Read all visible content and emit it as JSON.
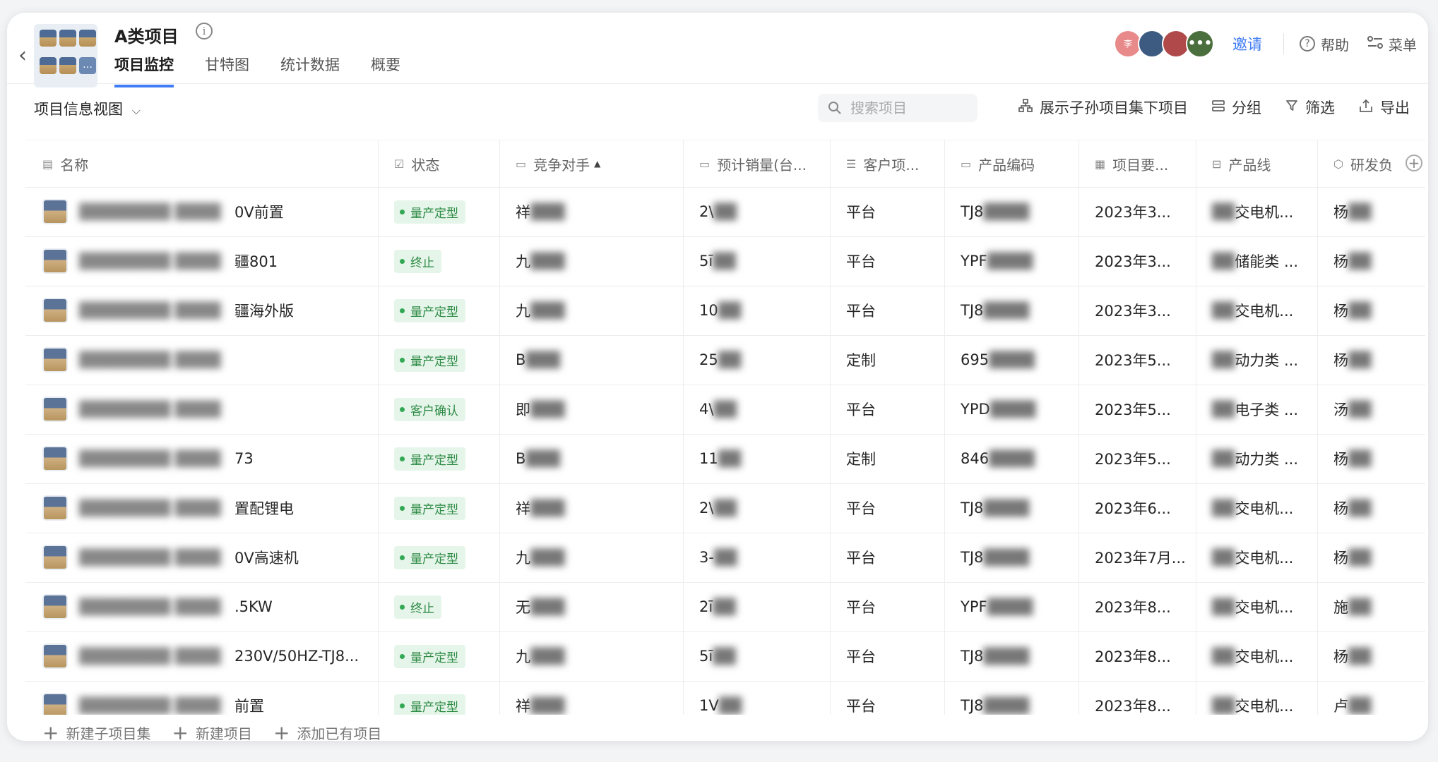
{
  "header": {
    "title": "A类项目",
    "tabs": [
      {
        "label": "项目监控",
        "active": true
      },
      {
        "label": "甘特图",
        "active": false
      },
      {
        "label": "统计数据",
        "active": false
      },
      {
        "label": "概要",
        "active": false
      }
    ],
    "avatars": [
      "李",
      "",
      "",
      "•••"
    ],
    "invite_label": "邀请",
    "help_label": "帮助",
    "menu_label": "菜单"
  },
  "toolbar": {
    "view_label": "项目信息视图",
    "search_placeholder": "搜索项目",
    "show_sub_label": "展示子孙项目集下项目",
    "group_label": "分组",
    "filter_label": "筛选",
    "export_label": "导出"
  },
  "table": {
    "headers": {
      "name": "名称",
      "status": "状态",
      "competitor": "竞争对手",
      "sales": "预计销量(台...",
      "customer": "客户项...",
      "code": "产品编码",
      "date": "项目要...",
      "line": "产品线",
      "rd": "研发负"
    },
    "rows": [
      {
        "name_suffix": "0V前置",
        "status": "量产定型",
        "competitor": "祥",
        "sales": "2\\",
        "customer": "平台",
        "code": "TJ8",
        "date": "2023年3...",
        "line": "交电机...",
        "rd": "杨"
      },
      {
        "name_suffix": "疆801",
        "status": "终止",
        "competitor": "九",
        "sales": "5ī",
        "customer": "平台",
        "code": "YPF",
        "date": "2023年3...",
        "line": "储能类 ...",
        "rd": "杨"
      },
      {
        "name_suffix": "疆海外版",
        "status": "量产定型",
        "competitor": "九",
        "sales": "10",
        "customer": "平台",
        "code": "TJ8",
        "date": "2023年3...",
        "line": "交电机...",
        "rd": "杨"
      },
      {
        "name_suffix": "",
        "status": "量产定型",
        "competitor": "B",
        "sales": "25",
        "customer": "定制",
        "code": "695",
        "date": "2023年5...",
        "line": "动力类 ...",
        "rd": "杨"
      },
      {
        "name_suffix": "",
        "status": "客户确认",
        "competitor": "即",
        "sales": "4\\",
        "customer": "平台",
        "code": "YPD",
        "date": "2023年5...",
        "line": "电子类 ...",
        "rd": "汤"
      },
      {
        "name_suffix": "73",
        "status": "量产定型",
        "competitor": "B",
        "sales": "11",
        "customer": "定制",
        "code": "846",
        "date": "2023年5...",
        "line": "动力类 ...",
        "rd": "杨"
      },
      {
        "name_suffix": "置配锂电",
        "status": "量产定型",
        "competitor": "祥",
        "sales": "2\\",
        "customer": "平台",
        "code": "TJ8",
        "date": "2023年6...",
        "line": "交电机...",
        "rd": "杨"
      },
      {
        "name_suffix": "0V高速机",
        "status": "量产定型",
        "competitor": "九",
        "sales": "3-",
        "customer": "平台",
        "code": "TJ8",
        "date": "2023年7月...",
        "line": "交电机...",
        "rd": "杨"
      },
      {
        "name_suffix": ".5KW",
        "status": "终止",
        "competitor": "无",
        "sales": "2ī",
        "customer": "平台",
        "code": "YPF",
        "date": "2023年8...",
        "line": "交电机...",
        "rd": "施"
      },
      {
        "name_suffix": "230V/50HZ-TJ8...",
        "status": "量产定型",
        "competitor": "九",
        "sales": "5ī",
        "customer": "平台",
        "code": "TJ8",
        "date": "2023年8...",
        "line": "交电机...",
        "rd": "杨"
      },
      {
        "name_suffix": "前置",
        "status": "量产定型",
        "competitor": "祥",
        "sales": "1V",
        "customer": "平台",
        "code": "TJ8",
        "date": "2023年8...",
        "line": "交电机...",
        "rd": "卢"
      }
    ]
  },
  "footer": {
    "new_subset": "新建子项目集",
    "new_project": "新建项目",
    "add_existing": "添加已有项目"
  },
  "colors": {
    "accent": "#3f7cf5",
    "badge_bg": "#e6f5ea",
    "badge_text": "#2c8a44"
  }
}
